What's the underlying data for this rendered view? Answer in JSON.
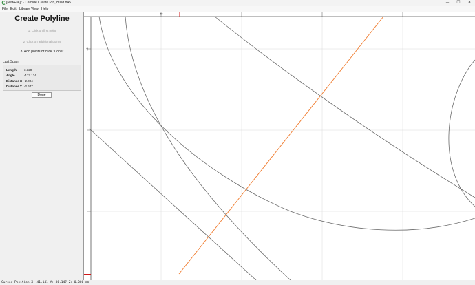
{
  "window": {
    "title": "[NewFile]* - Carbide Create Pro, Build 845",
    "minimize_glyph": "─",
    "maximize_glyph": "☐",
    "close_glyph": "✕"
  },
  "menu": [
    "File",
    "Edit",
    "Library",
    "View",
    "Help"
  ],
  "panel": {
    "title": "Create Polyline",
    "steps": [
      {
        "label": "1. Click on first point",
        "state": "done"
      },
      {
        "label": "2. Click on additional points",
        "state": "done"
      },
      {
        "label": "3. Add points or click \"Done\"",
        "state": "active"
      }
    ],
    "last_span_label": "Last Span",
    "last_span": [
      {
        "key": "Length",
        "value": "3.320"
      },
      {
        "key": "Angle",
        "value": "-127.134"
      },
      {
        "key": "Distance X",
        "value": "-2.004"
      },
      {
        "key": "Distance Y",
        "value": "-2.647"
      }
    ],
    "done_label": "Done"
  },
  "canvas": {
    "ruler_top_label": "40",
    "ruler_left_label": "40",
    "grid_color": "#d8d8d8",
    "geometry_color": "#6a6a6a",
    "polyline_color": "#f07a2c",
    "marker_color": "#d01818"
  },
  "status": {
    "cursor_label": "Cursor Position",
    "x": "41.141",
    "y": "36.147",
    "z": "0.000",
    "units": "mm"
  }
}
